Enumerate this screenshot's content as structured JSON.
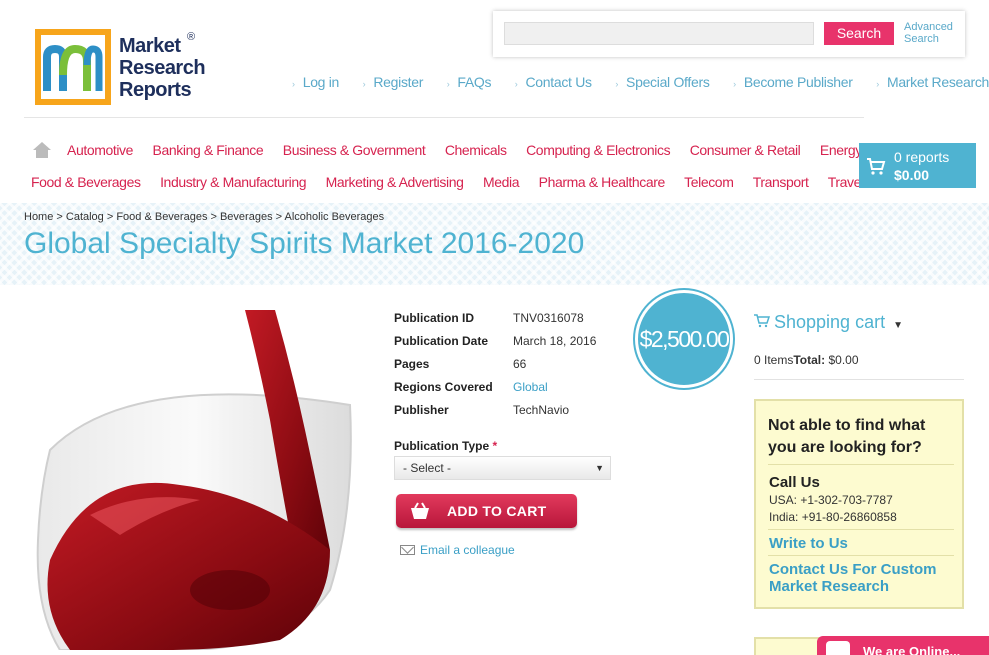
{
  "logo": {
    "line1": "Market",
    "line2": "Research",
    "line3": "Reports",
    "reg": "®"
  },
  "search": {
    "placeholder": "",
    "button_label": "Search",
    "advanced_line1": "Advanced",
    "advanced_line2": "Search"
  },
  "top_links": [
    "Log in",
    "Register",
    "FAQs",
    "Contact Us",
    "Special Offers",
    "Become Publisher",
    "Market Research Blog"
  ],
  "categories_row1": [
    "Automotive",
    "Banking & Finance",
    "Business & Government",
    "Chemicals",
    "Computing & Electronics",
    "Consumer & Retail",
    "Energy & Utilities"
  ],
  "categories_row2": [
    "Food & Beverages",
    "Industry & Manufacturing",
    "Marketing & Advertising",
    "Media",
    "Pharma & Healthcare",
    "Telecom",
    "Transport",
    "Travel & Leisure"
  ],
  "cart": {
    "reports": "0 reports",
    "amount": "$0.00"
  },
  "breadcrumb": "Home > Catalog > Food & Beverages > Beverages > Alcoholic Beverages",
  "title": "Global Specialty Spirits Market 2016-2020",
  "details": [
    {
      "label": "Publication ID",
      "value": "TNV0316078",
      "link": false
    },
    {
      "label": "Publication Date",
      "value": "March 18, 2016",
      "link": false
    },
    {
      "label": "Pages",
      "value": "66",
      "link": false
    },
    {
      "label": "Regions Covered",
      "value": "Global",
      "link": true
    },
    {
      "label": "Publisher",
      "value": "TechNavio",
      "link": false
    }
  ],
  "price": "$2,500.00",
  "publication_type": {
    "label": "Publication Type",
    "required_mark": "*",
    "selected": "- Select -"
  },
  "add_to_cart": "ADD TO CART",
  "email_colleague": "Email a colleague",
  "shopping_cart": {
    "title": "Shopping cart",
    "items": "0 Items",
    "total_label": "Total:",
    "total": " $0.00"
  },
  "help": {
    "question": "Not able to find what you are looking for?",
    "call_us": "Call Us",
    "usa": "USA: +1-302-703-7787",
    "india": "India: +91-80-26860858",
    "write": "Write to Us",
    "custom": "Contact Us For Custom Market Research"
  },
  "chat": "We are Online...",
  "colors": {
    "accent": "#4fb3d1",
    "brand_red": "#d6234f",
    "search_btn": "#e8336b"
  }
}
